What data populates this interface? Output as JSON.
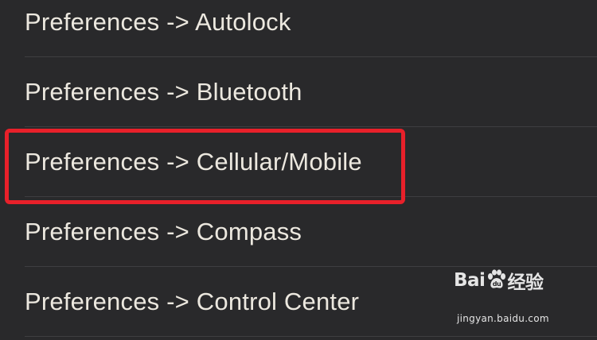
{
  "preferences_list": {
    "items": [
      {
        "label": "Preferences -> Autolock"
      },
      {
        "label": "Preferences -> Bluetooth"
      },
      {
        "label": "Preferences -> Cellular/Mobile"
      },
      {
        "label": "Preferences -> Compass"
      },
      {
        "label": "Preferences -> Control Center"
      }
    ]
  },
  "highlight": {
    "color": "#e8202a"
  },
  "watermark": {
    "brand_prefix": "Bai",
    "brand_suffix": "经验",
    "url": "jingyan.baidu.com",
    "icon": "baidu-paw-icon"
  }
}
